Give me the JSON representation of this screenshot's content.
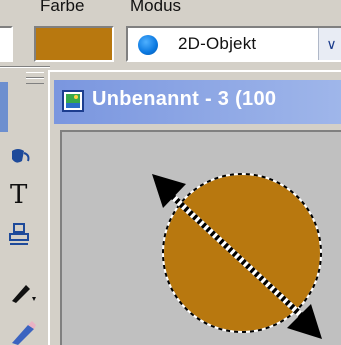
{
  "options_bar": {
    "color_label": "Farbe",
    "mode_label": "Modus",
    "color_value": "#b8780f",
    "mode_value": "2D-Objekt",
    "mode_icon": "blue-circle-icon",
    "dropdown_icon": "chevron-down-icon"
  },
  "document": {
    "title": "Unbenannt - 3 (100",
    "icon": "image-document-icon"
  },
  "canvas": {
    "shape": "circle",
    "shape_fill": "#b8780f",
    "selection_outline": "dashed",
    "handle_icon": "double-arrow-resize-icon"
  },
  "toolbox": {
    "tools": [
      {
        "name": "paint-bucket-icon"
      },
      {
        "name": "text-tool-icon",
        "glyph": "T"
      },
      {
        "name": "stamp-tool-icon"
      },
      {
        "name": "pen-tool-icon"
      },
      {
        "name": "pencil-tool-icon"
      }
    ]
  }
}
